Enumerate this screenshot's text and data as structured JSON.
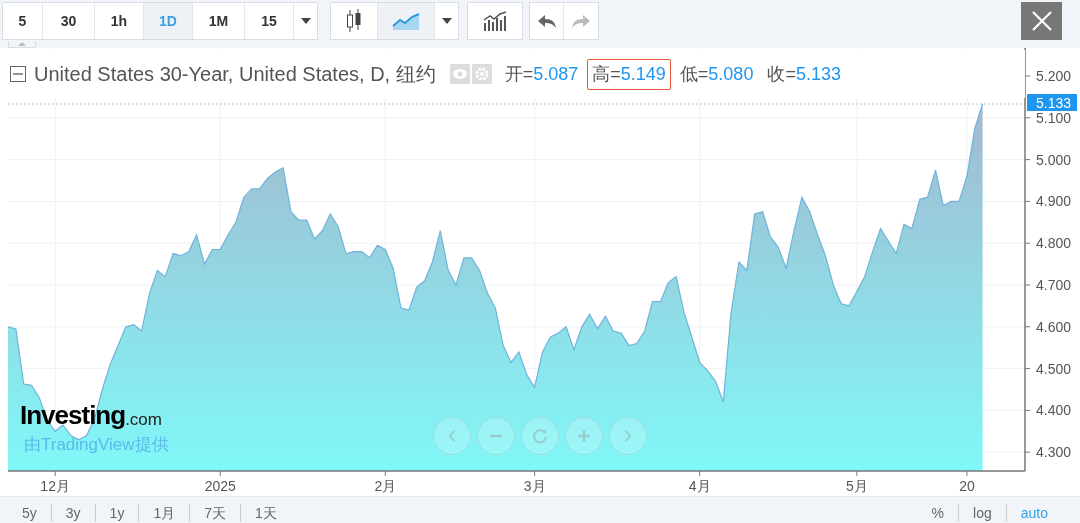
{
  "toolbar": {
    "intervals": [
      {
        "label": "5",
        "selected": false
      },
      {
        "label": "30",
        "selected": false
      },
      {
        "label": "1h",
        "selected": false
      },
      {
        "label": "1D",
        "selected": true
      },
      {
        "label": "1M",
        "selected": false
      },
      {
        "label": "15",
        "selected": false
      }
    ],
    "chart_styles": [
      {
        "kind": "candles",
        "selected": false
      },
      {
        "kind": "area",
        "selected": true
      }
    ],
    "history": [
      {
        "kind": "undo",
        "disabled": false
      },
      {
        "kind": "redo",
        "disabled": true
      }
    ]
  },
  "legend": {
    "title": "United States 30-Year, United States, D, 纽约",
    "ohlc": [
      {
        "label": "开=",
        "value": "5.087",
        "highlighted": false
      },
      {
        "label": "高=",
        "value": "5.149",
        "highlighted": true
      },
      {
        "label": "低=",
        "value": "5.080",
        "highlighted": false
      },
      {
        "label": "收=",
        "value": "5.133",
        "highlighted": false
      }
    ]
  },
  "chart": {
    "price_label": "5.133",
    "chart_data": {
      "type": "area",
      "grid": true,
      "categories": [
        null,
        null,
        null,
        null,
        null,
        null,
        "12月",
        null,
        null,
        null,
        null,
        null,
        null,
        null,
        null,
        null,
        null,
        null,
        null,
        null,
        null,
        null,
        null,
        null,
        null,
        null,
        null,
        "2025",
        null,
        null,
        null,
        null,
        null,
        null,
        null,
        null,
        null,
        null,
        null,
        null,
        null,
        null,
        null,
        null,
        null,
        null,
        null,
        null,
        "2月",
        null,
        null,
        null,
        null,
        null,
        null,
        null,
        null,
        null,
        null,
        null,
        null,
        null,
        null,
        null,
        null,
        null,
        null,
        "3月",
        null,
        null,
        null,
        null,
        null,
        null,
        null,
        null,
        null,
        null,
        null,
        null,
        null,
        null,
        null,
        null,
        null,
        null,
        null,
        null,
        "4月",
        null,
        null,
        null,
        null,
        null,
        null,
        null,
        null,
        null,
        null,
        null,
        null,
        null,
        null,
        null,
        null,
        null,
        null,
        null,
        "5月",
        null,
        null,
        null,
        null,
        null,
        null,
        null,
        null,
        null,
        null,
        null,
        null,
        null,
        "20",
        null,
        null
      ],
      "ylim": [
        4.255,
        5.267
      ],
      "yticks": [
        {
          "value": 5.2,
          "label": "5.200"
        },
        {
          "value": 5.1,
          "label": "5.100"
        },
        {
          "value": 5.0,
          "label": "5.000"
        },
        {
          "value": 4.9,
          "label": "4.900"
        },
        {
          "value": 4.8,
          "label": "4.800"
        },
        {
          "value": 4.7,
          "label": "4.700"
        },
        {
          "value": 4.6,
          "label": "4.600"
        },
        {
          "value": 4.5,
          "label": "4.500"
        },
        {
          "value": 4.4,
          "label": "4.400"
        },
        {
          "value": 4.3,
          "label": "4.300"
        }
      ],
      "ref_lines": [
        {
          "axis": "y",
          "value": 5.133
        }
      ],
      "series": [
        {
          "color": "#6fb3dc",
          "values": [
            4.6,
            4.595,
            4.463,
            4.46,
            4.43,
            4.375,
            4.35,
            4.365,
            4.34,
            4.33,
            4.34,
            4.38,
            4.45,
            4.51,
            4.555,
            4.6,
            4.605,
            4.59,
            4.68,
            4.735,
            4.72,
            4.775,
            4.77,
            4.78,
            4.82,
            4.75,
            4.785,
            4.785,
            4.82,
            4.85,
            4.91,
            4.93,
            4.93,
            4.955,
            4.97,
            4.98,
            4.875,
            4.855,
            4.855,
            4.81,
            4.83,
            4.87,
            4.84,
            4.775,
            4.78,
            4.78,
            4.765,
            4.795,
            4.785,
            4.74,
            4.645,
            4.64,
            4.695,
            4.71,
            4.755,
            4.83,
            4.735,
            4.7,
            4.765,
            4.765,
            4.735,
            4.68,
            4.645,
            4.555,
            4.515,
            4.54,
            4.485,
            4.455,
            4.54,
            4.575,
            4.585,
            4.6,
            4.545,
            4.6,
            4.63,
            4.595,
            4.625,
            4.59,
            4.585,
            4.555,
            4.56,
            4.59,
            4.66,
            4.66,
            4.705,
            4.72,
            4.635,
            4.575,
            4.515,
            4.495,
            4.47,
            4.42,
            4.635,
            4.755,
            4.735,
            4.87,
            4.875,
            4.815,
            4.79,
            4.74,
            4.83,
            4.91,
            4.875,
            4.82,
            4.77,
            4.7,
            4.655,
            4.65,
            4.685,
            4.72,
            4.78,
            4.835,
            4.805,
            4.775,
            4.845,
            4.835,
            4.905,
            4.91,
            4.975,
            4.89,
            4.9,
            4.9,
            4.96,
            5.075,
            5.133
          ]
        }
      ]
    }
  },
  "branding": {
    "logo": "Investing",
    "logo_suffix": ".com",
    "provider": "由TradingView提供"
  },
  "range_buttons": [
    "5y",
    "3y",
    "1y",
    "1月",
    "7天",
    "1天"
  ],
  "scale_options": [
    {
      "label": "%",
      "selected": false
    },
    {
      "label": "log",
      "selected": false
    },
    {
      "label": "auto",
      "selected": true
    }
  ]
}
